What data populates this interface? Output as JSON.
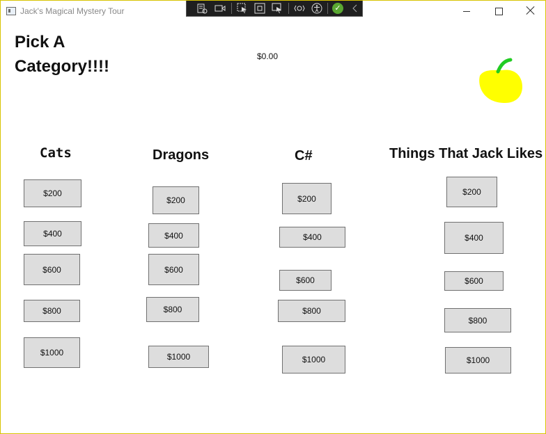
{
  "window": {
    "title": "Jack's Magical Mystery Tour"
  },
  "heading": {
    "line1": "Pick A",
    "line2": "Category!!!!"
  },
  "score": "$0.00",
  "colors": {
    "apple": "#ffff00",
    "stem": "#22cc22",
    "button_bg": "#dddddd",
    "window_border": "#d8c400"
  },
  "dev_toolbar": {
    "icons": [
      "live-visual-tree-icon",
      "video-icon",
      "select-element-icon",
      "display-layout-adorners-icon",
      "track-focus-icon",
      "hot-reload-icon",
      "accessibility-icon",
      "binding-check-icon",
      "collapse-chevron-icon"
    ]
  },
  "categories": [
    {
      "name": "Cats",
      "values": [
        "$200",
        "$400",
        "$600",
        "$800",
        "$1000"
      ]
    },
    {
      "name": "Dragons",
      "values": [
        "$200",
        "$400",
        "$600",
        "$800",
        "$1000"
      ]
    },
    {
      "name": "C#",
      "values": [
        "$200",
        "$400",
        "$600",
        "$800",
        "$1000"
      ]
    },
    {
      "name": "Things That Jack Likes",
      "values": [
        "$200",
        "$400",
        "$600",
        "$800",
        "$1000"
      ]
    }
  ]
}
